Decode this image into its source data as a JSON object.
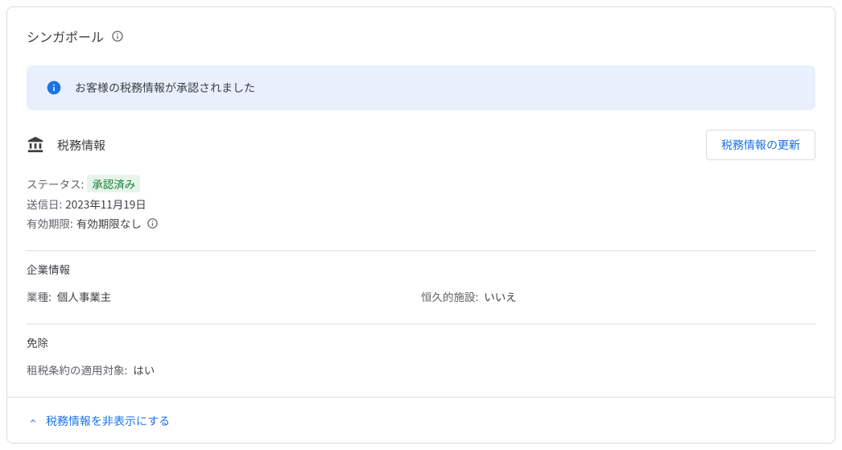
{
  "header": {
    "country_title": "シンガポール"
  },
  "alert": {
    "message": "お客様の税務情報が承認されました"
  },
  "tax_info": {
    "section_title": "税務情報",
    "update_button_label": "税務情報の更新",
    "status_label": "ステータス:",
    "status_value": "承認済み",
    "submitted_label": "送信日:",
    "submitted_value": "2023年11月19日",
    "expiry_label": "有効期限:",
    "expiry_value": "有効期限なし"
  },
  "company_info": {
    "section_title": "企業情報",
    "business_type_label": "業種:",
    "business_type_value": "個人事業主",
    "permanent_establishment_label": "恒久的施設:",
    "permanent_establishment_value": "いいえ"
  },
  "exemption": {
    "section_title": "免除",
    "tax_treaty_label": "租税条約の適用対象:",
    "tax_treaty_value": "はい"
  },
  "footer": {
    "collapse_label": "税務情報を非表示にする"
  }
}
